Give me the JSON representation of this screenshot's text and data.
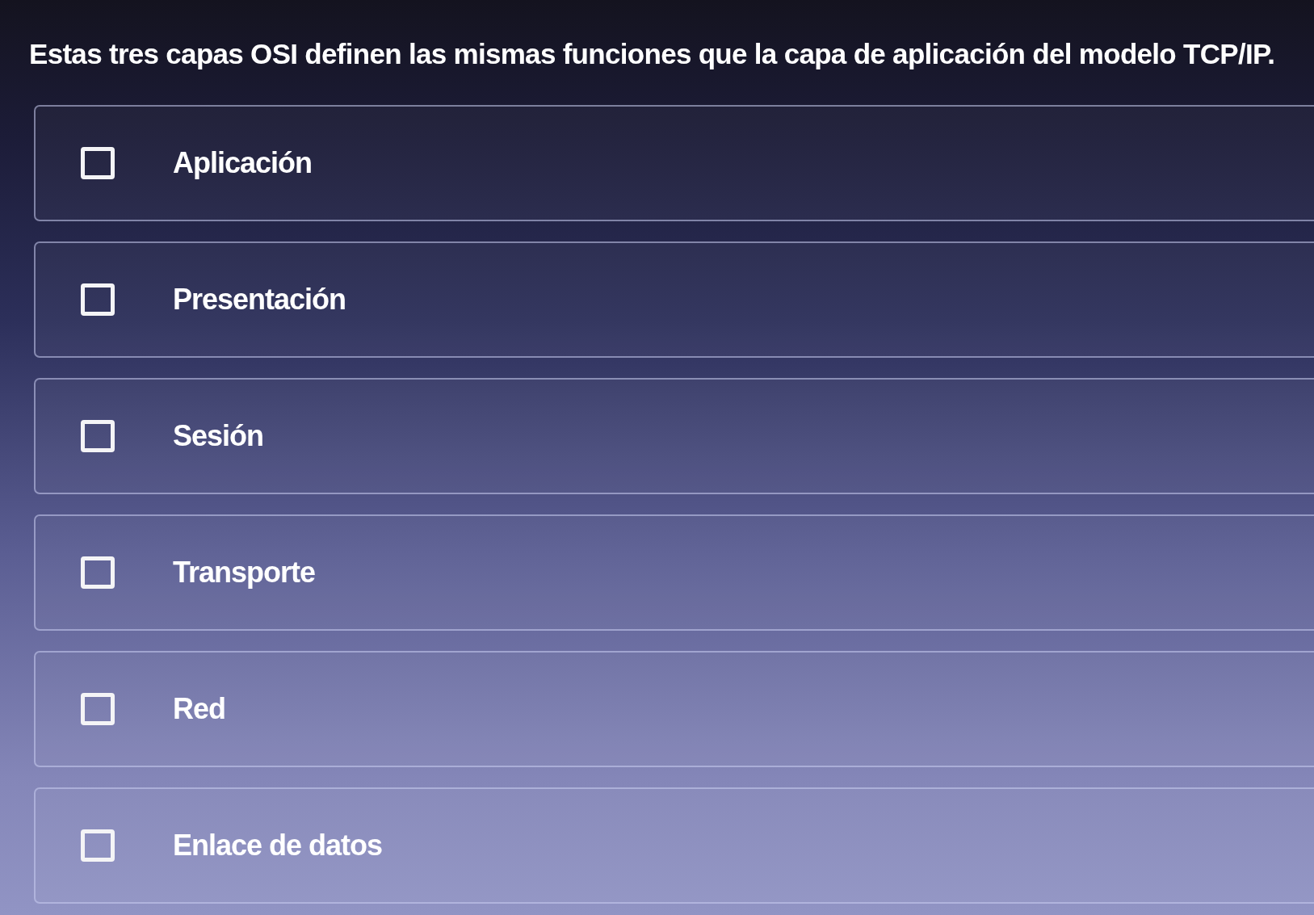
{
  "question": "Estas tres capas OSI definen las mismas funciones que la capa de aplicación del modelo TCP/IP.",
  "options": [
    {
      "label": "Aplicación",
      "checked": false
    },
    {
      "label": "Presentación",
      "checked": false
    },
    {
      "label": "Sesión",
      "checked": false
    },
    {
      "label": "Transporte",
      "checked": false
    },
    {
      "label": "Red",
      "checked": false
    },
    {
      "label": "Enlace de datos",
      "checked": false
    }
  ]
}
